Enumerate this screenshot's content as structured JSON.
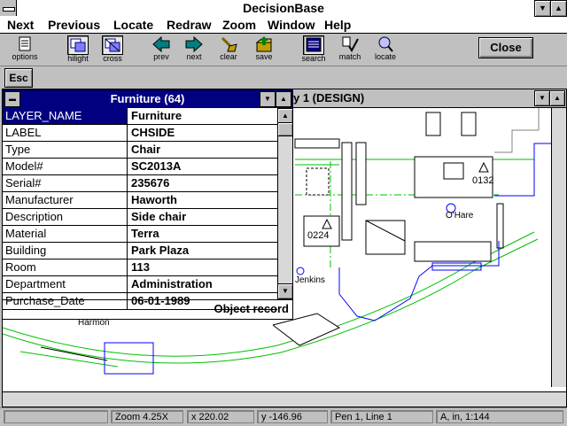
{
  "window": {
    "title": "DecisionBase"
  },
  "menu": [
    "Next",
    "Previous",
    "Locate",
    "Redraw",
    "Zoom",
    "Window",
    "Help"
  ],
  "toolbar": {
    "tools": [
      {
        "name": "options",
        "label": "options",
        "icon": "options-icon"
      },
      {
        "name": "hilight",
        "label": "hilight",
        "icon": "hilight-icon"
      },
      {
        "name": "cross",
        "label": "cross",
        "icon": "cross-icon"
      },
      {
        "name": "prev",
        "label": "prev",
        "icon": "left-arrow-icon"
      },
      {
        "name": "next",
        "label": "next",
        "icon": "right-arrow-icon"
      },
      {
        "name": "clear",
        "label": "clear",
        "icon": "clear-icon"
      },
      {
        "name": "save",
        "label": "save",
        "icon": "save-icon"
      },
      {
        "name": "search",
        "label": "search",
        "icon": "search-icon"
      },
      {
        "name": "match",
        "label": "match",
        "icon": "match-icon"
      },
      {
        "name": "locate",
        "label": "locate",
        "icon": "locate-icon"
      }
    ],
    "close_label": "Close"
  },
  "esc_label": "Esc",
  "drawing": {
    "title": "y 1 (DESIGN)",
    "labels": {
      "room_0132": "0132",
      "room_0224": "0224",
      "person_ohare": "O'Hare",
      "person_jenkins": "Jenkins",
      "person_harmon": "Harmon"
    }
  },
  "popup": {
    "title": "Furniture (64)",
    "rows": [
      {
        "key": "LAYER_NAME",
        "value": "Furniture"
      },
      {
        "key": "LABEL",
        "value": "CHSIDE"
      },
      {
        "key": "Type",
        "value": "Chair"
      },
      {
        "key": "Model#",
        "value": "SC2013A"
      },
      {
        "key": "Serial#",
        "value": "235676"
      },
      {
        "key": "Manufacturer",
        "value": "Haworth"
      },
      {
        "key": "Description",
        "value": "Side chair"
      },
      {
        "key": "Material",
        "value": "Terra"
      },
      {
        "key": "Building",
        "value": "Park Plaza"
      },
      {
        "key": "Room",
        "value": "113"
      },
      {
        "key": "Department",
        "value": "Administration"
      },
      {
        "key": "Purchase_Date",
        "value": "06-01-1989"
      }
    ],
    "footer": "Object record"
  },
  "status": {
    "zoom": "Zoom 4.25X",
    "x": "x 220.02",
    "y": "y -146.96",
    "pen": "Pen 1,  Line 1",
    "scale": "A, in, 1:144"
  },
  "colors": {
    "selection": "#000080",
    "wall_green": "#00c000",
    "wall_blue": "#0000ff",
    "line_green_dashed": "#00c000"
  }
}
